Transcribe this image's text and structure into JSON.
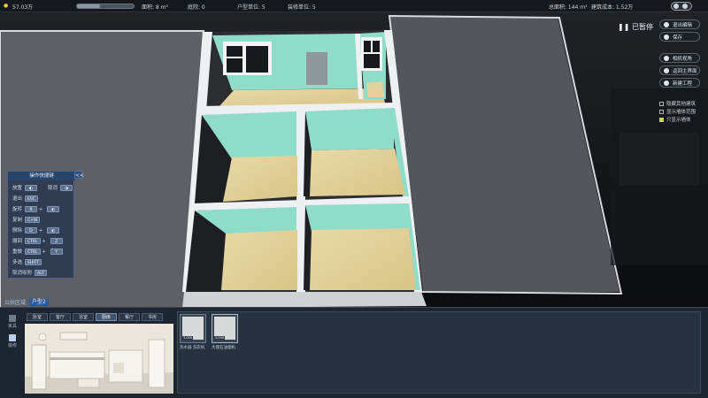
{
  "topbar": {
    "balance": "57.03万",
    "area": "面积: 8 m²",
    "bay": "庭院: 0",
    "households": "户型单位: 5",
    "rooms": "装修单位: 5",
    "total_area": "总面积: 144 m²",
    "total_cost": "建筑成本: 1.52万"
  },
  "status": {
    "paused": "已暂停"
  },
  "right_menu": [
    {
      "label": "退出编辑",
      "icon": "power-icon"
    },
    {
      "label": "保存",
      "icon": "power-icon"
    },
    {
      "label": "相机视角",
      "icon": "camera-icon"
    },
    {
      "label": "返回主界面",
      "icon": "home-icon"
    },
    {
      "label": "新建工程",
      "icon": "tools-icon"
    }
  ],
  "toggles": [
    {
      "label": "隐藏其他建筑",
      "checked": false
    },
    {
      "label": "显示墙体范围",
      "checked": false
    },
    {
      "label": "只显示墙体",
      "checked": true
    }
  ],
  "controls": {
    "title": "操作快捷键",
    "collapse": "<<",
    "rows": [
      {
        "label": "放置",
        "keys": [],
        "extra": "取消"
      },
      {
        "label": "退出",
        "keys": [
          "ESC"
        ]
      },
      {
        "label": "旋转",
        "keys": [
          "R"
        ]
      },
      {
        "label": "复制",
        "keys": [
          "C+W"
        ]
      },
      {
        "label": "删除",
        "keys": [
          "D"
        ]
      },
      {
        "label": "撤回",
        "keys": [
          "CTRL",
          "Z"
        ]
      },
      {
        "label": "重做",
        "keys": [
          "CTRL",
          "Y"
        ]
      },
      {
        "label": "多选",
        "keys": [
          "SHIFT"
        ]
      },
      {
        "label": "取消吸附",
        "keys": [
          "ALT"
        ]
      }
    ]
  },
  "breadcrumb": {
    "section": "公共区域",
    "current": "户型2"
  },
  "room_tabs": [
    {
      "label": "卧室",
      "active": false
    },
    {
      "label": "客厅",
      "active": false
    },
    {
      "label": "浴室",
      "active": false
    },
    {
      "label": "厨房",
      "active": true
    },
    {
      "label": "餐厅",
      "active": false
    },
    {
      "label": "书房",
      "active": false
    }
  ],
  "side_icons": [
    {
      "label": "家具",
      "selected": false
    },
    {
      "label": "装修",
      "selected": true
    }
  ],
  "items": [
    {
      "name": "热水器",
      "sub": "洗衣机",
      "price": "3,000"
    },
    {
      "name": "大理石油烟机",
      "sub": "",
      "price": "3,000"
    }
  ]
}
